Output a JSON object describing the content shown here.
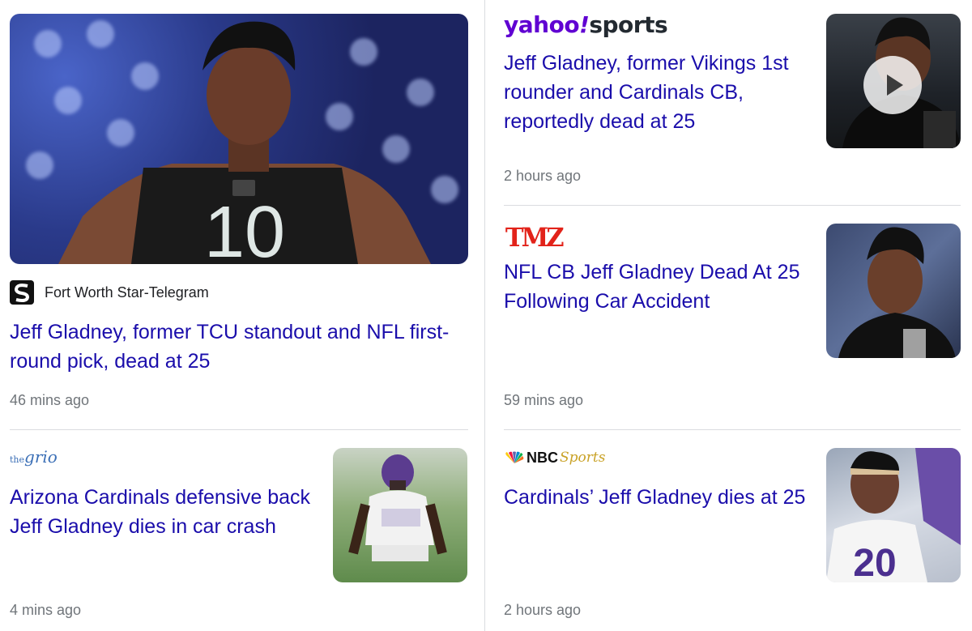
{
  "stories": [
    {
      "source": "Fort Worth Star-Telegram",
      "headline": "Jeff Gladney, former TCU standout and NFL first-round pick, dead at 25",
      "time": "46 mins ago",
      "image": "football player wearing black #10 jersey",
      "jersey_number": "10"
    },
    {
      "source_logo_text": "yahoo!sports",
      "logo_part1": "yahoo",
      "logo_bang": "!",
      "logo_part2": "sports",
      "headline": "Jeff Gladney, former Vikings 1st rounder and Cardinals CB, reportedly dead at 25",
      "time": "2 hours ago",
      "image": "player portrait video thumbnail",
      "has_video": true
    },
    {
      "source_logo_text": "TMZ",
      "headline": "NFL CB Jeff Gladney Dead At 25 Following Car Accident",
      "time": "59 mins ago",
      "image": "player at press conference"
    },
    {
      "source_logo_text": "thegrio",
      "logo_small": "the",
      "logo_big": "grio",
      "headline": "Arizona Cardinals defensive back Jeff Gladney dies in car crash",
      "time": "4 mins ago",
      "image": "Vikings player in purple helmet"
    },
    {
      "source_logo_text": "NBC Sports",
      "logo_nbc": "NBC",
      "logo_sports": "Sports",
      "headline": "Cardinals’ Jeff Gladney dies at 25",
      "time": "2 hours ago",
      "image": "Vikings player number 20",
      "jersey_number": "20"
    }
  ],
  "colors": {
    "headline": "#1a0dab",
    "time": "#70757a",
    "divider": "#dadce0",
    "yahoo_purple": "#6001d2",
    "tmz_red": "#e2231a",
    "grio_blue": "#3b6fb6",
    "nbc_gold": "#c9a227"
  }
}
